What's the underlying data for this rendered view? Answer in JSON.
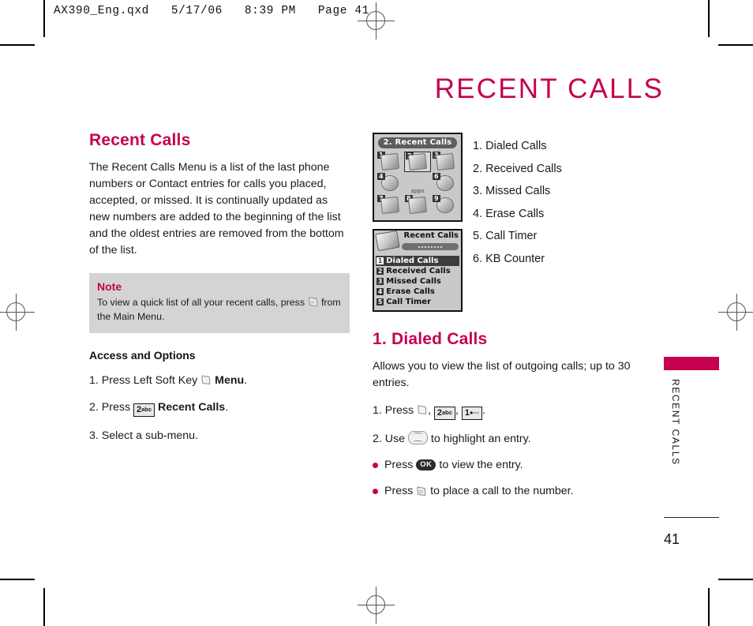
{
  "print_header": {
    "slug": "AX390_Eng.qxd   5/17/06   8:39 PM   Page 41"
  },
  "chapter": {
    "title": "RECENT CALLS",
    "side_tab_label": "RECENT CALLS",
    "page_number": "41",
    "accent_color": "#c5004f"
  },
  "left_column": {
    "heading": "Recent Calls",
    "intro": "The Recent Calls Menu is a list of the last phone numbers or Contact entries for calls you placed, accepted, or missed. It is continually updated as new numbers are added to the beginning of the list and the oldest entries are removed from the bottom of the list.",
    "note": {
      "title": "Note",
      "text_before_icon": "To view a quick list of all your recent calls, press",
      "icon": "send-key-icon",
      "text_after_icon": "from the Main Menu."
    },
    "access": {
      "subhead": "Access and Options",
      "step1_pre": "1. Press Left Soft Key",
      "step1_icon": "left-soft-key-icon",
      "step1_bold": "Menu",
      "step1_post": ".",
      "step2_pre": "2. Press",
      "step2_key": "2",
      "step2_key_sub": "abc",
      "step2_bold": "Recent Calls",
      "step2_post": ".",
      "step3": "3. Select a sub-menu."
    }
  },
  "screenshots": {
    "grid": {
      "title": "2. Recent Calls",
      "selected_index": 1,
      "tiles": [
        {
          "num": "1",
          "art": "square"
        },
        {
          "num": "2",
          "art": "square"
        },
        {
          "num": "3",
          "art": "square"
        },
        {
          "num": "4",
          "art": "round"
        },
        {
          "num": "",
          "art": "caption",
          "caption": "apps"
        },
        {
          "num": "6",
          "art": "round"
        },
        {
          "num": "7",
          "art": "square"
        },
        {
          "num": "8",
          "art": "square"
        },
        {
          "num": "9",
          "art": "round"
        }
      ]
    },
    "list": {
      "title": "Recent Calls",
      "rows": [
        {
          "num": "1",
          "label": "Dialed Calls",
          "selected": true
        },
        {
          "num": "2",
          "label": "Received Calls",
          "selected": false
        },
        {
          "num": "3",
          "label": "Missed Calls",
          "selected": false
        },
        {
          "num": "4",
          "label": "Erase Calls",
          "selected": false
        },
        {
          "num": "5",
          "label": "Call Timer",
          "selected": false
        }
      ]
    }
  },
  "menu_list": [
    "1. Dialed Calls",
    "2. Received Calls",
    "3. Missed Calls",
    "4. Erase Calls",
    "5. Call Timer",
    "6. KB Counter"
  ],
  "dialed_calls": {
    "heading": "1. Dialed Calls",
    "description": "Allows you to view the list of outgoing calls; up to 30 entries.",
    "step1_pre": "1. Press",
    "step1_key2": "2",
    "step1_key2_sub": "abc",
    "step1_key1": "1",
    "step1_post": ".",
    "step2_pre": "2.  Use",
    "step2_post": "to highlight an entry.",
    "bullet1_pre": "Press",
    "bullet1_key": "OK",
    "bullet1_post": "to view the entry.",
    "bullet2_pre": "Press",
    "bullet2_post": "to place a call to the number."
  }
}
